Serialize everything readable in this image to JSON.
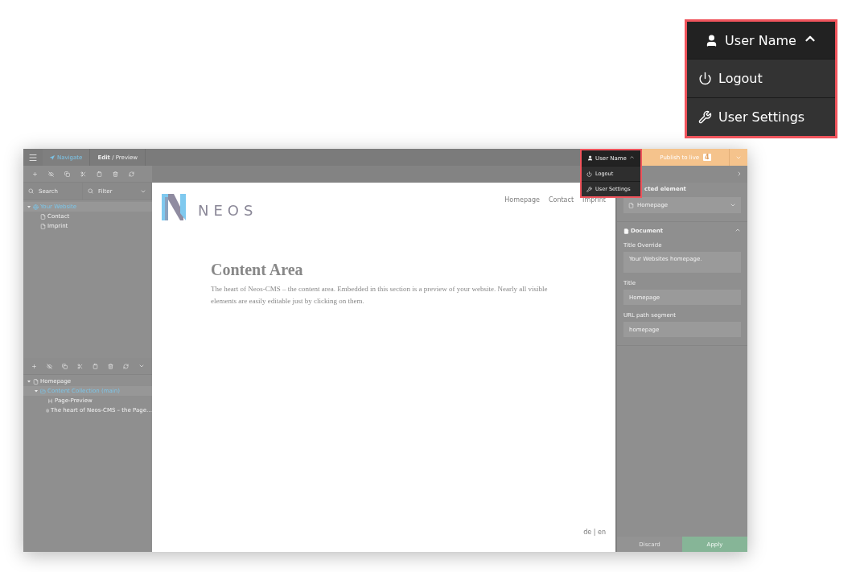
{
  "top_bar": {
    "tabs": [
      {
        "label": "Navigate",
        "selected": true
      },
      {
        "label": "**Edit** / Preview",
        "selected": false
      }
    ],
    "user_menu": {
      "label": "User Name",
      "expanded": true,
      "items": [
        {
          "label": "Logout",
          "kind": "logout"
        },
        {
          "label": "User Settings",
          "kind": "settings"
        }
      ]
    },
    "publish": {
      "label": "Publish to live",
      "count": "4"
    }
  },
  "page_tree": {
    "search": {
      "placeholder": "Search"
    },
    "filter": {
      "placeholder": "Filter"
    },
    "nodes": [
      {
        "label": "Your Website",
        "kind": "site",
        "selected": true,
        "expanded": true,
        "children": [
          {
            "label": "Contact",
            "kind": "page",
            "selected": false
          },
          {
            "label": "Imprint",
            "kind": "page",
            "selected": false
          }
        ]
      }
    ]
  },
  "content_tree": {
    "nodes": [
      {
        "label": "Homepage",
        "kind": "page",
        "selected": false,
        "expanded": true,
        "children": [
          {
            "label": "Content Collection (main)",
            "kind": "collection",
            "selected": true,
            "expanded": true,
            "children": [
              {
                "label": "Page-Preview",
                "kind": "headline",
                "selected": false
              },
              {
                "label": "The heart of Neos-CMS – the Page…",
                "kind": "text",
                "selected": false
              }
            ]
          }
        ]
      }
    ]
  },
  "preview": {
    "logo": "NEOS",
    "nav": [
      "Homepage",
      "Contact",
      "Imprint"
    ],
    "heading": "Content Area",
    "body": "The heart of Neos-CMS – the content area. Embedded in this section is a preview of your website. Nearly all visible elements are easily editable just by clicking on them.",
    "languages": "de | en"
  },
  "inspector": {
    "selected_label": "cted element",
    "node_select": "Homepage",
    "section": {
      "title": "Document",
      "expanded": true
    },
    "fields": [
      {
        "label": "Title Override",
        "value": "Your Websites homepage.",
        "kind": "textarea"
      },
      {
        "label": "Title",
        "value": "Homepage",
        "kind": "input"
      },
      {
        "label": "URL path segment",
        "value": "homepage",
        "kind": "input"
      }
    ],
    "discard": "Discard",
    "apply": "Apply"
  },
  "callout": {
    "label": "User Name",
    "expanded": true,
    "items": [
      {
        "label": "Logout",
        "kind": "logout"
      },
      {
        "label": "User Settings",
        "kind": "settings"
      }
    ]
  }
}
